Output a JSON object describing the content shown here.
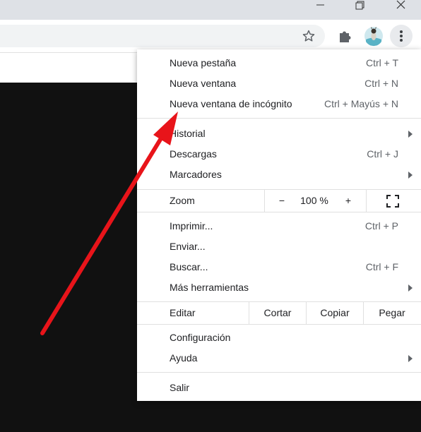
{
  "menu": {
    "sections": [
      [
        {
          "label": "Nueva pestaña",
          "shortcut": "Ctrl + T"
        },
        {
          "label": "Nueva ventana",
          "shortcut": "Ctrl + N"
        },
        {
          "label": "Nueva ventana de incógnito",
          "shortcut": "Ctrl + Mayús + N"
        }
      ],
      [
        {
          "label": "Historial",
          "shortcut": ""
        },
        {
          "label": "Descargas",
          "shortcut": "Ctrl + J"
        },
        {
          "label": "Marcadores",
          "shortcut": ""
        }
      ]
    ],
    "zoom": {
      "label": "Zoom",
      "minus": "−",
      "value": "100 %",
      "plus": "+"
    },
    "tools": [
      {
        "label": "Imprimir...",
        "shortcut": "Ctrl + P"
      },
      {
        "label": "Enviar...",
        "shortcut": ""
      },
      {
        "label": "Buscar...",
        "shortcut": "Ctrl + F"
      },
      {
        "label": "Más herramientas",
        "shortcut": ""
      }
    ],
    "edit": {
      "label": "Editar",
      "cut": "Cortar",
      "copy": "Copiar",
      "paste": "Pegar"
    },
    "settings": [
      {
        "label": "Configuración"
      },
      {
        "label": "Ayuda"
      }
    ],
    "exit": {
      "label": "Salir"
    }
  },
  "colors": {
    "annotation_arrow": "#e8141a"
  }
}
